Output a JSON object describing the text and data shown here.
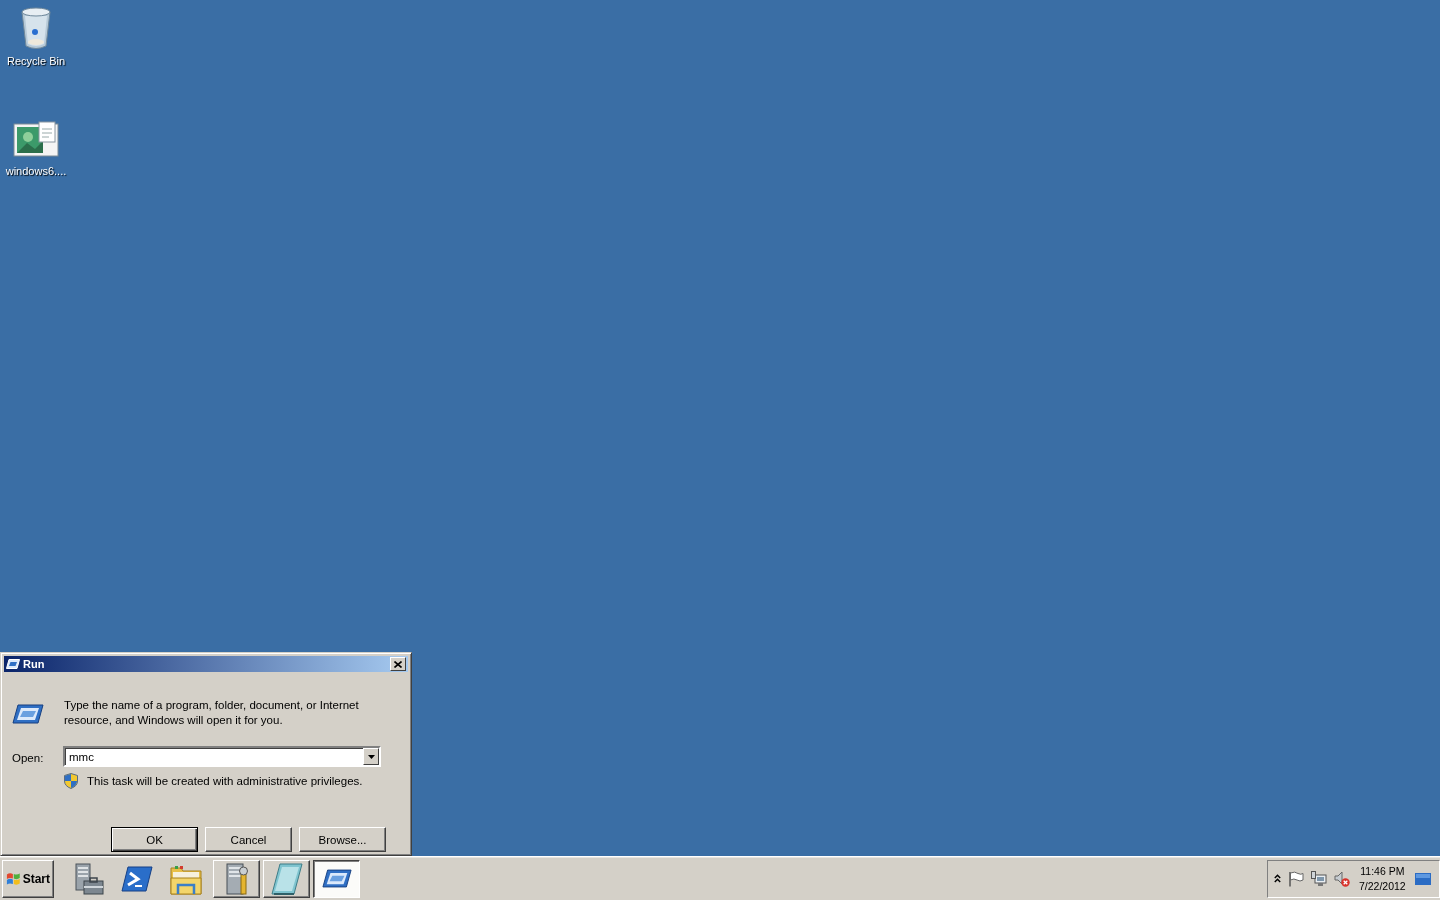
{
  "desktop": {
    "icons": [
      {
        "label": "Recycle Bin",
        "kind": "recycle-bin"
      },
      {
        "label": "windows6....",
        "kind": "image-file"
      }
    ]
  },
  "run_dialog": {
    "title": "Run",
    "instruction": "Type the name of a program, folder, document, or Internet resource, and Windows will open it for you.",
    "open_label": "Open:",
    "open_value": "mmc",
    "admin_note": "This task will be created with administrative privileges.",
    "buttons": [
      {
        "label": "OK",
        "default": true
      },
      {
        "label": "Cancel",
        "default": false
      },
      {
        "label": "Browse...",
        "default": false
      }
    ]
  },
  "taskbar": {
    "start_label": "Start",
    "quick_launch": [
      {
        "kind": "server-manager"
      },
      {
        "kind": "powershell"
      },
      {
        "kind": "explorer"
      }
    ],
    "buttons": [
      {
        "kind": "server-tools",
        "selected": false
      },
      {
        "kind": "notepad",
        "selected": false
      },
      {
        "kind": "run",
        "selected": true
      }
    ],
    "tray": {
      "time": "11:46 PM",
      "date": "7/22/2012",
      "volume_muted": true
    }
  }
}
